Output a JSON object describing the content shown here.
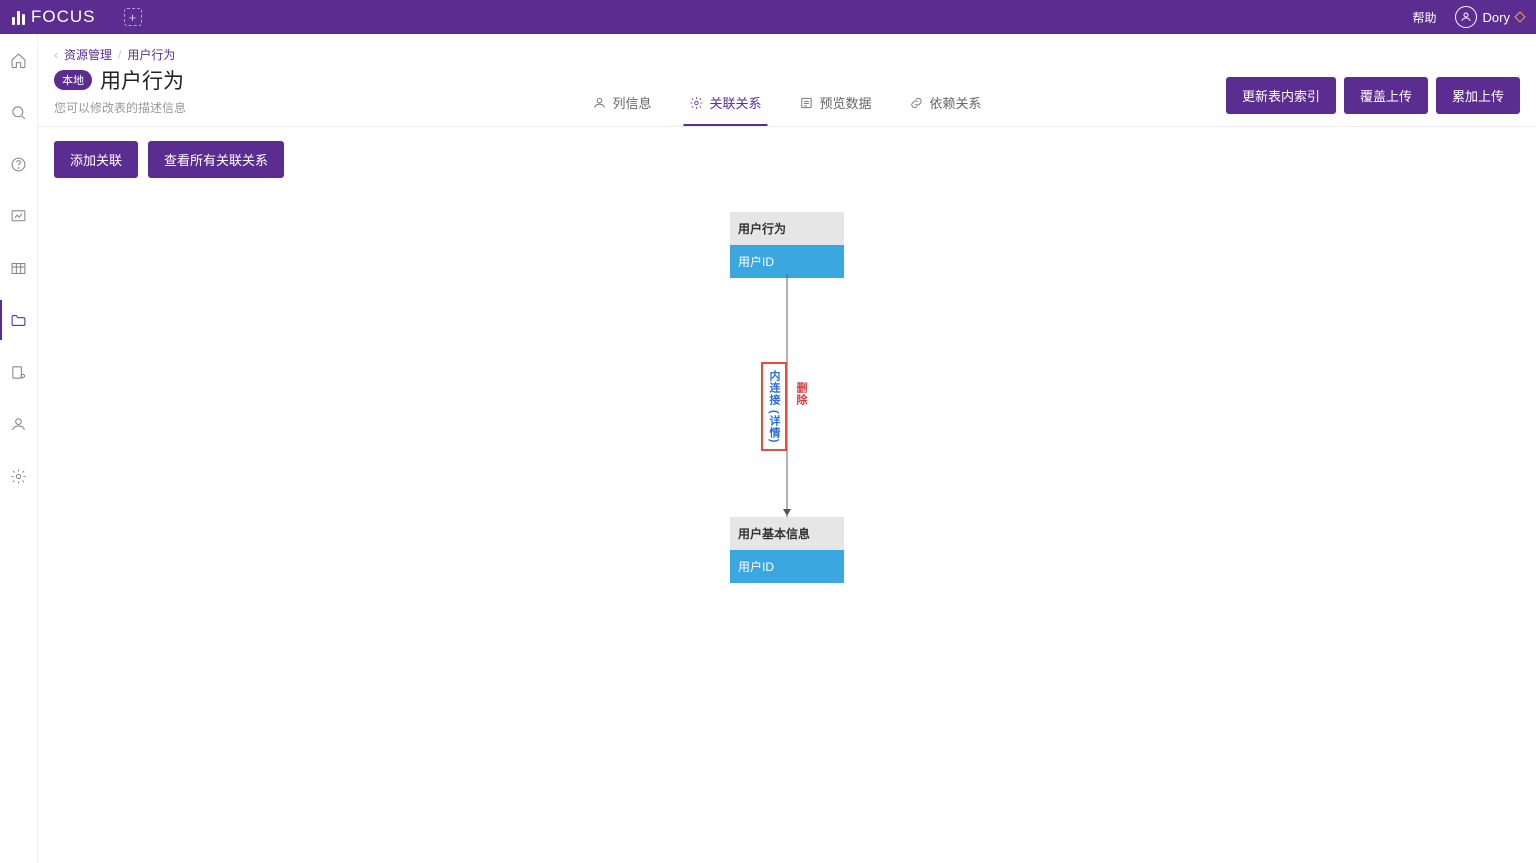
{
  "brand": "FOCUS",
  "topbar": {
    "help": "帮助",
    "user": "Dory"
  },
  "breadcrumb": {
    "parent": "资源管理",
    "current": "用户行为"
  },
  "header": {
    "badge": "本地",
    "title": "用户行为",
    "subtitle": "您可以修改表的描述信息"
  },
  "tabs": {
    "columns": "列信息",
    "relations": "关联关系",
    "preview": "预览数据",
    "dependency": "依赖关系"
  },
  "actions": {
    "updateIndex": "更新表内索引",
    "overwrite": "覆盖上传",
    "append": "累加上传"
  },
  "toolbar": {
    "addRelation": "添加关联",
    "viewAll": "查看所有关联关系"
  },
  "diagram": {
    "source": {
      "table": "用户行为",
      "field": "用户ID"
    },
    "target": {
      "table": "用户基本信息",
      "field": "用户ID"
    },
    "joinLabel": "内连接 (详情)",
    "deleteLabel": "删除"
  }
}
